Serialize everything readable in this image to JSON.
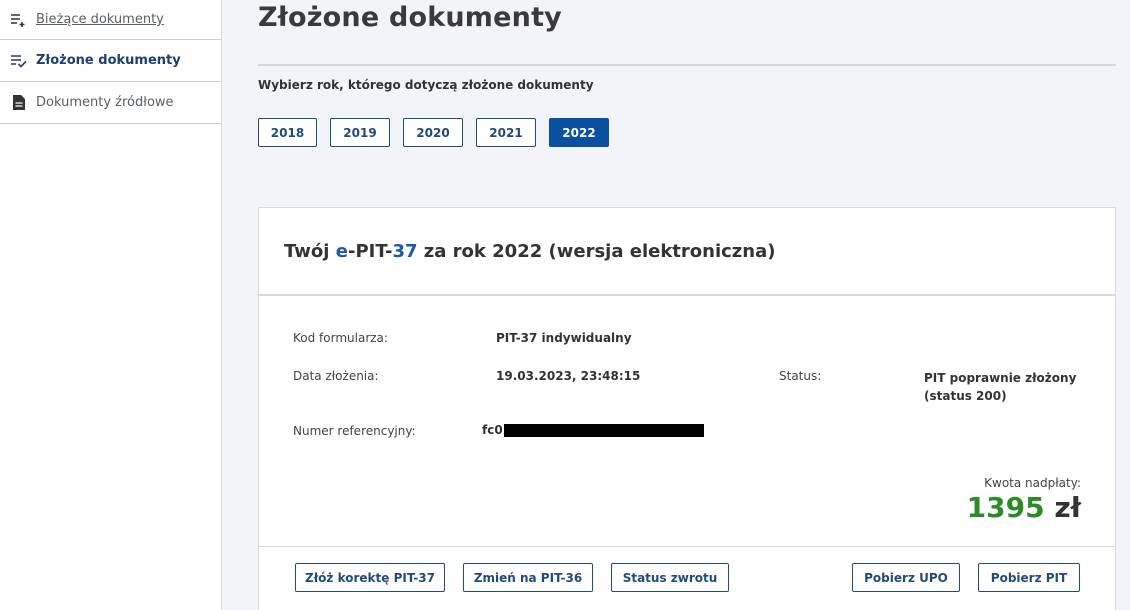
{
  "sidebar": {
    "items": [
      {
        "label": "Bieżące dokumenty",
        "icon": "list-add-icon"
      },
      {
        "label": "Złożone dokumenty",
        "icon": "list-check-icon"
      },
      {
        "label": "Dokumenty źródłowe",
        "icon": "document-icon"
      }
    ]
  },
  "header": {
    "title": "Złożone dokumenty",
    "year_prompt": "Wybierz rok, którego dotyczą złożone dokumenty"
  },
  "years": [
    "2018",
    "2019",
    "2020",
    "2021",
    "2022"
  ],
  "selected_year": "2022",
  "card": {
    "title_prefix": "Twój ",
    "title_e": "e",
    "title_dash": "-PIT-",
    "title_num": "37",
    "title_suffix": " za rok 2022 (wersja elektroniczna)",
    "form_code_label": "Kod formularza:",
    "form_code_value": "PIT-37 indywidualny",
    "date_label": "Data złożenia:",
    "date_value": "19.03.2023, 23:48:15",
    "status_label": "Status:",
    "status_value_line1": "PIT poprawnie złożony",
    "status_value_line2": "(status 200)",
    "ref_label": "Numer referencyjny:",
    "ref_value_visible": "fc0",
    "amount_label": "Kwota nadpłaty:",
    "amount_value": "1395",
    "amount_currency": "zł"
  },
  "actions": {
    "correction": "Złóż korektę PIT-37",
    "change": "Zmień na PIT-36",
    "refund_status": "Status zwrotu",
    "download_upo": "Pobierz UPO",
    "download_pit": "Pobierz PIT"
  },
  "colors": {
    "accent": "#0b4fa0",
    "outline": "#234b7a",
    "amount_green": "#2d8a26"
  }
}
